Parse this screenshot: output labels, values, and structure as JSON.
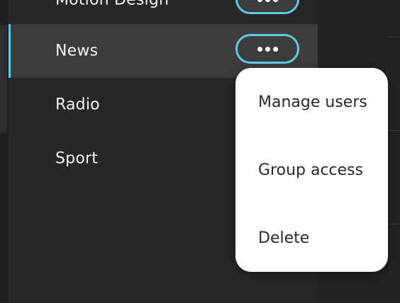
{
  "group_list": {
    "items": [
      {
        "label": "Motion Design",
        "selected": false,
        "has_menu_button": true
      },
      {
        "label": "News",
        "selected": true,
        "has_menu_button": true
      },
      {
        "label": "Radio",
        "selected": false,
        "has_menu_button": false
      },
      {
        "label": "Sport",
        "selected": false,
        "has_menu_button": false
      }
    ]
  },
  "context_menu": {
    "items": [
      {
        "label": "Manage users"
      },
      {
        "label": "Group access"
      },
      {
        "label": "Delete"
      }
    ]
  },
  "icons": {
    "more": "more-horizontal-icon"
  },
  "colors": {
    "accent": "#5fc9e6",
    "panel_bg": "#272727",
    "selected_row_bg": "#3c3c3c",
    "menu_bg": "#ffffff",
    "text_light": "#f2f2f2",
    "text_dark": "#2a2a2a"
  }
}
